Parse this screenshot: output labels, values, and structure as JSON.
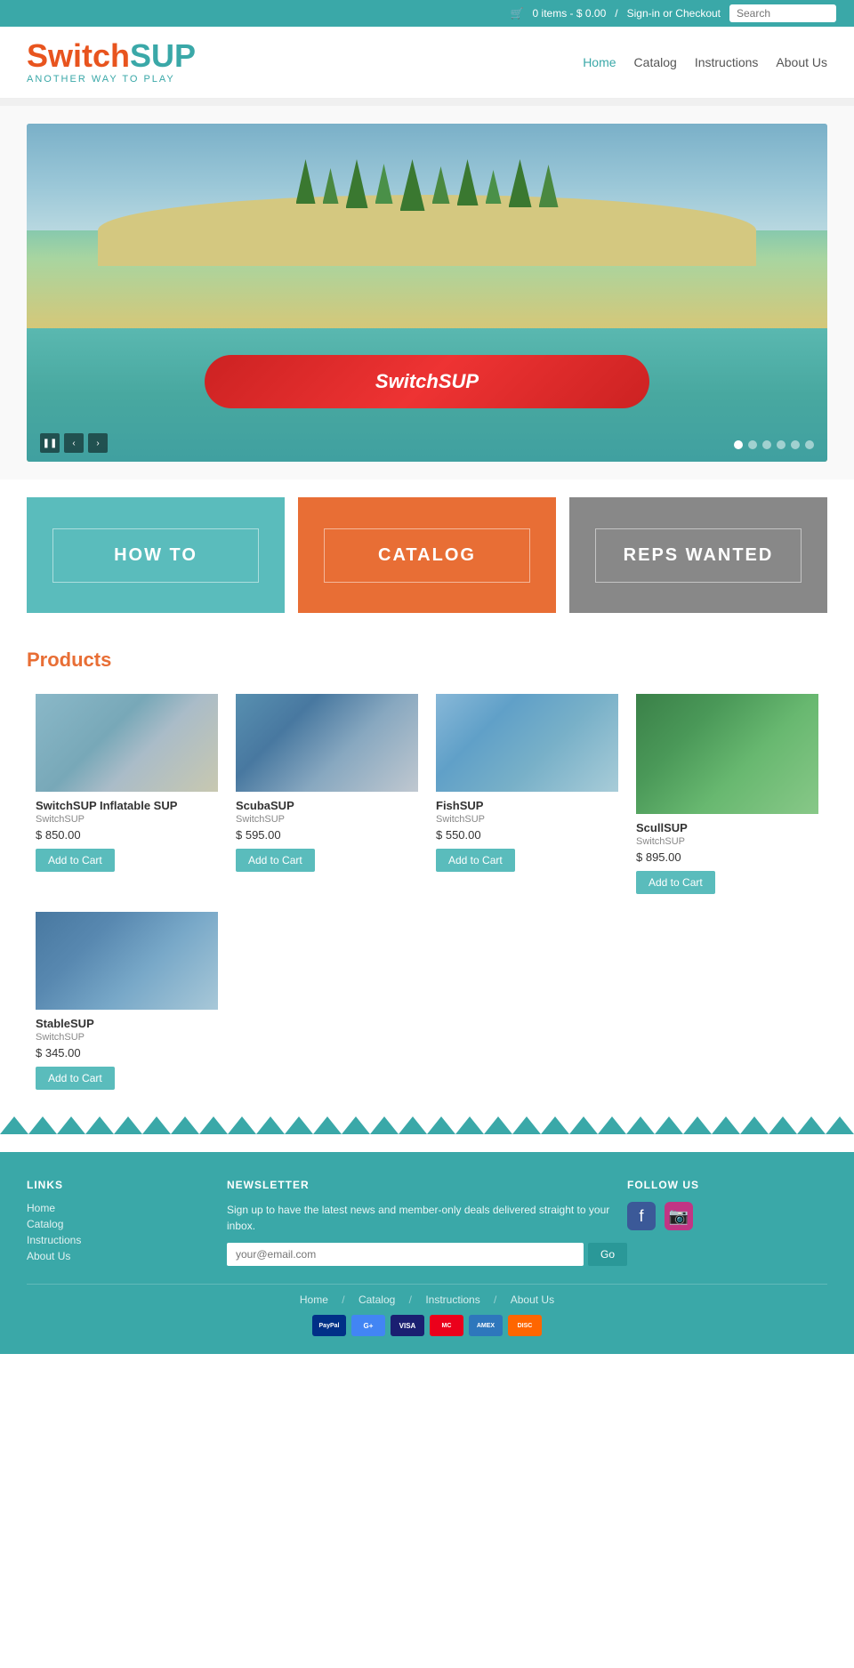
{
  "topbar": {
    "cart_text": "0 items - $ 0.00",
    "separator": "/",
    "signin_text": "Sign-in or Checkout",
    "search_placeholder": "Search"
  },
  "header": {
    "logo_switch": "Switch",
    "logo_sup": "SUP",
    "tagline": "ANOTHER WAY TO PLAY",
    "nav": {
      "home": "Home",
      "catalog": "Catalog",
      "instructions": "Instructions",
      "about": "About Us"
    }
  },
  "hero": {
    "board_text": "SwitchSUP",
    "controls": {
      "pause": "❚❚",
      "prev": "‹",
      "next": "›"
    },
    "dots": 6
  },
  "categories": [
    {
      "label": "HOW TO",
      "color": "teal"
    },
    {
      "label": "CATALOG",
      "color": "orange"
    },
    {
      "label": "REPS WANTED",
      "color": "gray"
    }
  ],
  "products_title": "Products",
  "products": [
    {
      "name": "SwitchSUP Inflatable SUP",
      "brand": "SwitchSUP",
      "price": "$ 850.00",
      "btn": "Add to Cart",
      "img_class": "prod-img-1"
    },
    {
      "name": "ScubaSUP",
      "brand": "SwitchSUP",
      "price": "$ 595.00",
      "btn": "Add to Cart",
      "img_class": "prod-img-2"
    },
    {
      "name": "FishSUP",
      "brand": "SwitchSUP",
      "price": "$ 550.00",
      "btn": "Add to Cart",
      "img_class": "prod-img-3"
    },
    {
      "name": "ScullSUP",
      "brand": "SwitchSUP",
      "price": "$ 895.00",
      "btn": "Add to Cart",
      "img_class": "prod-img-4"
    },
    {
      "name": "StableSUP",
      "brand": "SwitchSUP",
      "price": "$ 345.00",
      "btn": "Add to Cart",
      "img_class": "prod-img-5"
    }
  ],
  "footer": {
    "links_title": "LINKS",
    "links": [
      "Home",
      "Catalog",
      "Instructions",
      "About Us"
    ],
    "newsletter_title": "NEWSLETTER",
    "newsletter_text": "Sign up to have the latest news and member-only deals delivered straight to your inbox.",
    "newsletter_placeholder": "your@email.com",
    "newsletter_btn": "Go",
    "follow_title": "FOLLOW US",
    "bottom_nav": [
      "Home",
      "Catalog",
      "Instructions",
      "About Us"
    ],
    "payments": [
      "PayPal",
      "G",
      "VISA",
      "MC",
      "AMEX",
      "DISC"
    ]
  }
}
